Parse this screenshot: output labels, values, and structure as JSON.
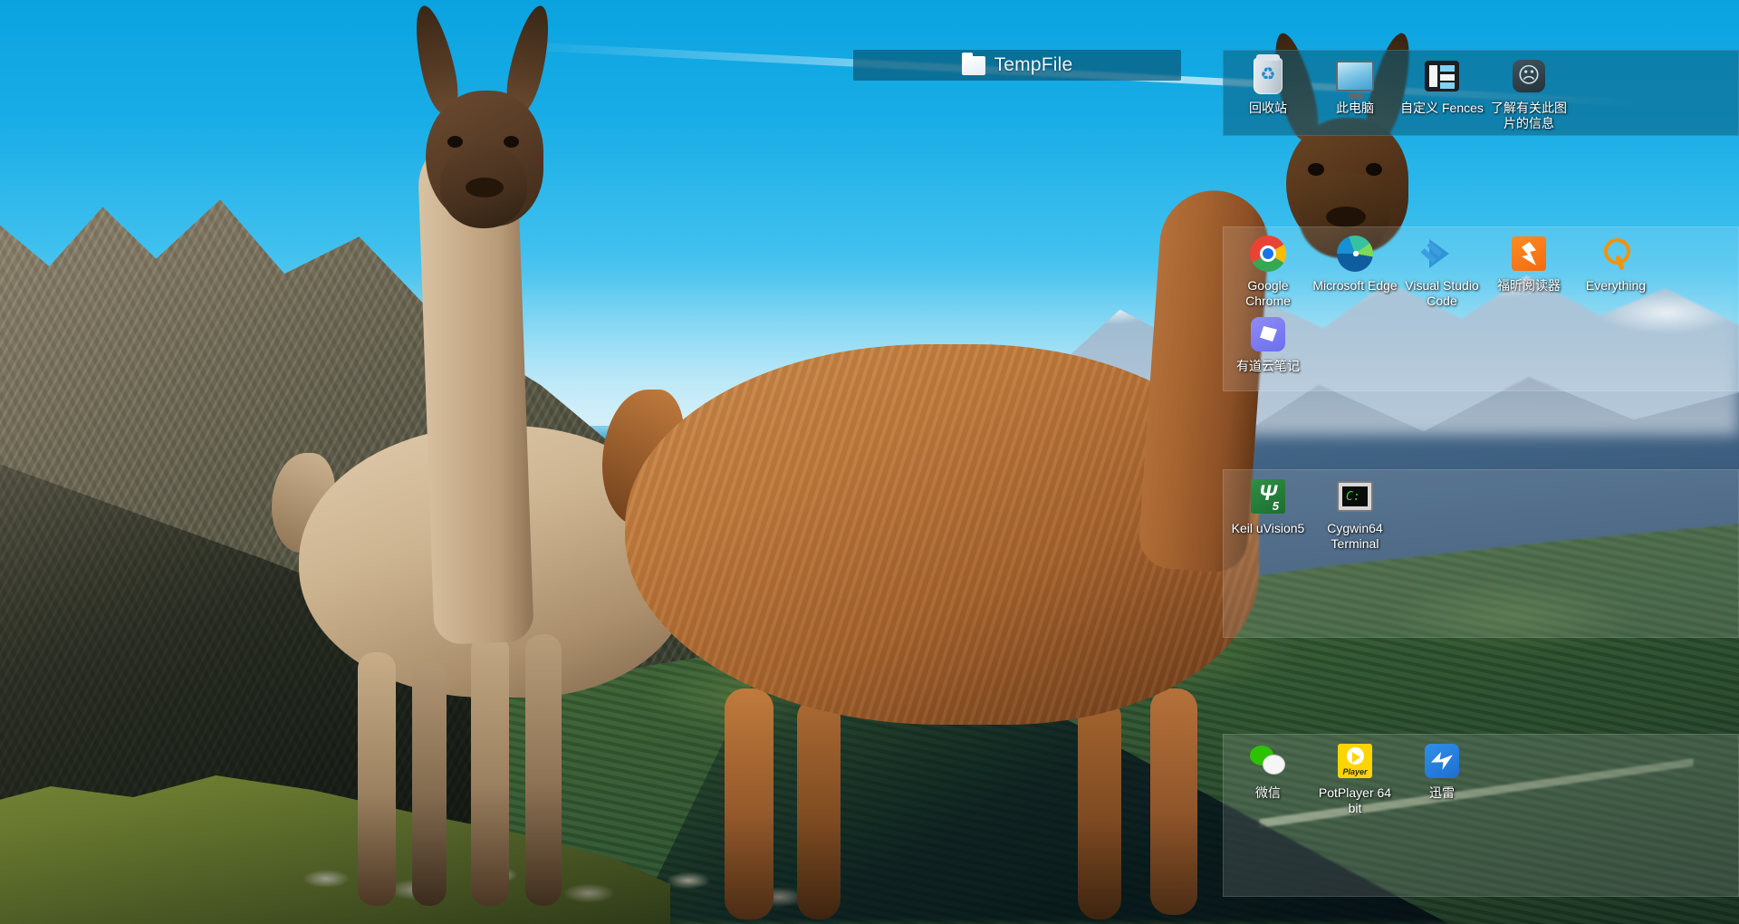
{
  "desktop": {
    "wallpaper_description": "Two llamas standing on an alpine ridge with mountains and blue sky",
    "accent_color": "#0b7fa8",
    "fence_title_bar_color": "#085a7a",
    "fence_body_color": "rgba(255,255,255,0.13)"
  },
  "fences": [
    {
      "id": "tempfile",
      "title": "TempFile",
      "icon": "folder-icon",
      "items": []
    },
    {
      "id": "system",
      "title": "",
      "items": [
        {
          "label": "回收站",
          "icon": "recycle-bin-icon"
        },
        {
          "label": "此电脑",
          "icon": "this-pc-icon"
        },
        {
          "label": "自定义 Fences",
          "icon": "fences-icon"
        },
        {
          "label": "了解有关此图片的信息",
          "icon": "image-info-icon"
        }
      ]
    },
    {
      "id": "apps",
      "title": "",
      "items": [
        {
          "label": "Google Chrome",
          "icon": "chrome-icon"
        },
        {
          "label": "Microsoft Edge",
          "icon": "edge-icon"
        },
        {
          "label": "Visual Studio Code",
          "icon": "vscode-icon"
        },
        {
          "label": "福昕阅读器",
          "icon": "foxit-reader-icon"
        },
        {
          "label": "Everything",
          "icon": "everything-icon"
        },
        {
          "label": "有道云笔记",
          "icon": "youdao-note-icon"
        }
      ]
    },
    {
      "id": "dev-tools",
      "title": "",
      "items": [
        {
          "label": "Keil uVision5",
          "icon": "keil-uvision-icon"
        },
        {
          "label": "Cygwin64 Terminal",
          "icon": "cygwin-terminal-icon"
        }
      ]
    },
    {
      "id": "media",
      "title": "",
      "items": [
        {
          "label": "微信",
          "icon": "wechat-icon"
        },
        {
          "label": "PotPlayer 64 bit",
          "icon": "potplayer-icon"
        },
        {
          "label": "迅雷",
          "icon": "xunlei-icon"
        }
      ]
    }
  ],
  "potplayer_badge": "Player"
}
